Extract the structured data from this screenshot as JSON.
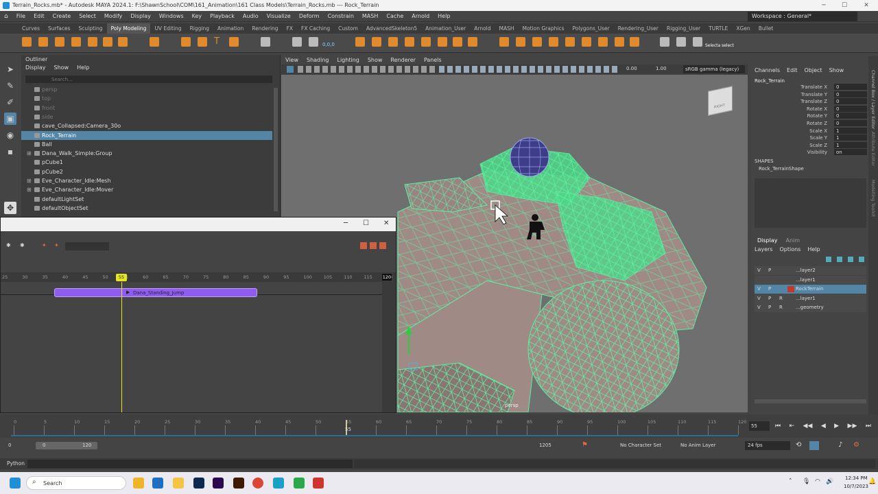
{
  "titlebar": {
    "title": "Terrain_Rocks.mb* - Autodesk MAYA 2024.1: F:\\ShawnSchool\\COM\\161_Animation\\161 Class Models\\Terrain_Rocks.mb  ---  Rock_Terrain",
    "minimize": "─",
    "maximize": "☐",
    "close": "✕"
  },
  "menubar": {
    "items": [
      "File",
      "Edit",
      "Create",
      "Select",
      "Modify",
      "Display",
      "Windows",
      "Key",
      "Playback",
      "Audio",
      "Visualize",
      "Deform",
      "Constrain",
      "MASH",
      "Cache",
      "Arnold",
      "Help"
    ],
    "workspace": "Workspace : General*"
  },
  "shelftabs": {
    "items": [
      "Curves",
      "Surfaces",
      "Sculpting",
      "Poly Modeling",
      "UV Editing",
      "Rigging",
      "Animation",
      "Rendering",
      "FX",
      "FX Caching",
      "Custom",
      "AdvancedSkeleton5",
      "Animation_User",
      "Arnold",
      "MASH",
      "Motion Graphics",
      "Polygons_User",
      "Rendering_User",
      "Rigging_User",
      "TURTLE",
      "XGen",
      "Bullet"
    ],
    "active": "Poly Modeling"
  },
  "shelf": {
    "coord": "0,0,0",
    "select1": "Selecta",
    "select2": "select"
  },
  "outliner": {
    "title": "Outliner",
    "menus": [
      "Display",
      "Show",
      "Help"
    ],
    "search_placeholder": "Search...",
    "items": [
      {
        "label": "persp",
        "dim": true
      },
      {
        "label": "top",
        "dim": true
      },
      {
        "label": "front",
        "dim": true
      },
      {
        "label": "side",
        "dim": true
      },
      {
        "label": "cave_Collapsed:Camera_30o",
        "dim": false
      },
      {
        "label": "Rock_Terrain",
        "dim": false,
        "sel": true
      },
      {
        "label": "Ball",
        "dim": false
      },
      {
        "label": "Dana_Walk_Simple:Group",
        "dim": false,
        "exp": true
      },
      {
        "label": "pCube1",
        "dim": false
      },
      {
        "label": "pCube2",
        "dim": false
      },
      {
        "label": "Eve_Character_Idle:Mesh",
        "dim": false,
        "exp": true
      },
      {
        "label": "Eve_Character_Idle:Mover",
        "dim": false,
        "exp": true
      },
      {
        "label": "defaultLightSet",
        "dim": false
      },
      {
        "label": "defaultObjectSet",
        "dim": false
      }
    ]
  },
  "viewport": {
    "menus": [
      "View",
      "Shading",
      "Lighting",
      "Show",
      "Renderer",
      "Panels"
    ],
    "exposure": "0.00",
    "gamma": "1.00",
    "colorspace": "sRGB gamma (legacy)",
    "cube_label": "RIGHT",
    "camera": "persp"
  },
  "channelbox": {
    "menus": [
      "Channels",
      "Edit",
      "Object",
      "Show"
    ],
    "object": "Rock_Terrain",
    "attrs": [
      {
        "name": "Translate X",
        "value": "0"
      },
      {
        "name": "Translate Y",
        "value": "0"
      },
      {
        "name": "Translate Z",
        "value": "0"
      },
      {
        "name": "Rotate X",
        "value": "0"
      },
      {
        "name": "Rotate Y",
        "value": "0"
      },
      {
        "name": "Rotate Z",
        "value": "0"
      },
      {
        "name": "Scale X",
        "value": "1"
      },
      {
        "name": "Scale Y",
        "value": "1"
      },
      {
        "name": "Scale Z",
        "value": "1"
      },
      {
        "name": "Visibility",
        "value": "on"
      }
    ],
    "shapes_title": "SHAPES",
    "shape": "Rock_TerrainShape"
  },
  "layers": {
    "tabs": [
      "Display",
      "Anim"
    ],
    "menus": [
      "Layers",
      "Options",
      "Help"
    ],
    "items": [
      {
        "v": "V",
        "p": "P",
        "r": "",
        "name": "...layer2",
        "sel": false
      },
      {
        "v": "",
        "p": "",
        "r": "",
        "name": "...layer1",
        "sel": false
      },
      {
        "v": "V",
        "p": "P",
        "r": "",
        "name": "RockTerrain",
        "sel": true,
        "color": "#c0392b"
      },
      {
        "v": "V",
        "p": "P",
        "r": "R",
        "name": "...layer1",
        "sel": false
      },
      {
        "v": "V",
        "p": "P",
        "r": "R",
        "name": "...geometry",
        "sel": false
      }
    ]
  },
  "rightstrip": {
    "labels": [
      "Channel Box / Layer Editor",
      "Attribute Editor",
      "Modelling Toolkit"
    ]
  },
  "trax": {
    "ticks": [
      "25",
      "30",
      "35",
      "40",
      "45",
      "50",
      "55",
      "60",
      "65",
      "70",
      "75",
      "80",
      "85",
      "90",
      "95",
      "100",
      "105",
      "110",
      "115",
      "120"
    ],
    "current": "55",
    "clip": "Dana_Standing_Jump",
    "end": "120"
  },
  "timeline": {
    "ticks": [
      "0",
      "5",
      "10",
      "15",
      "20",
      "25",
      "30",
      "35",
      "40",
      "45",
      "50",
      "55",
      "60",
      "65",
      "70",
      "75",
      "80",
      "85",
      "90",
      "95",
      "100",
      "105",
      "110",
      "115",
      "120"
    ],
    "current_frame": "55",
    "marker": "55"
  },
  "rangebar": {
    "start": "0",
    "inner_start": "0",
    "inner_end": "120",
    "end": "1205",
    "character": "No Character Set",
    "anim_layer": "No Anim Layer",
    "fps": "24 fps"
  },
  "cmdline": {
    "label": "Python"
  },
  "taskbar": {
    "search": "Search",
    "time": "12:34 PM",
    "date": "10/7/2023"
  },
  "colors": {
    "wire": "#5cf0a0",
    "terrain": "#a08a86",
    "sel": "#5285a6",
    "clip": "#8f5cf0",
    "playhead": "#e6e622",
    "accent": "#e08a2e"
  }
}
